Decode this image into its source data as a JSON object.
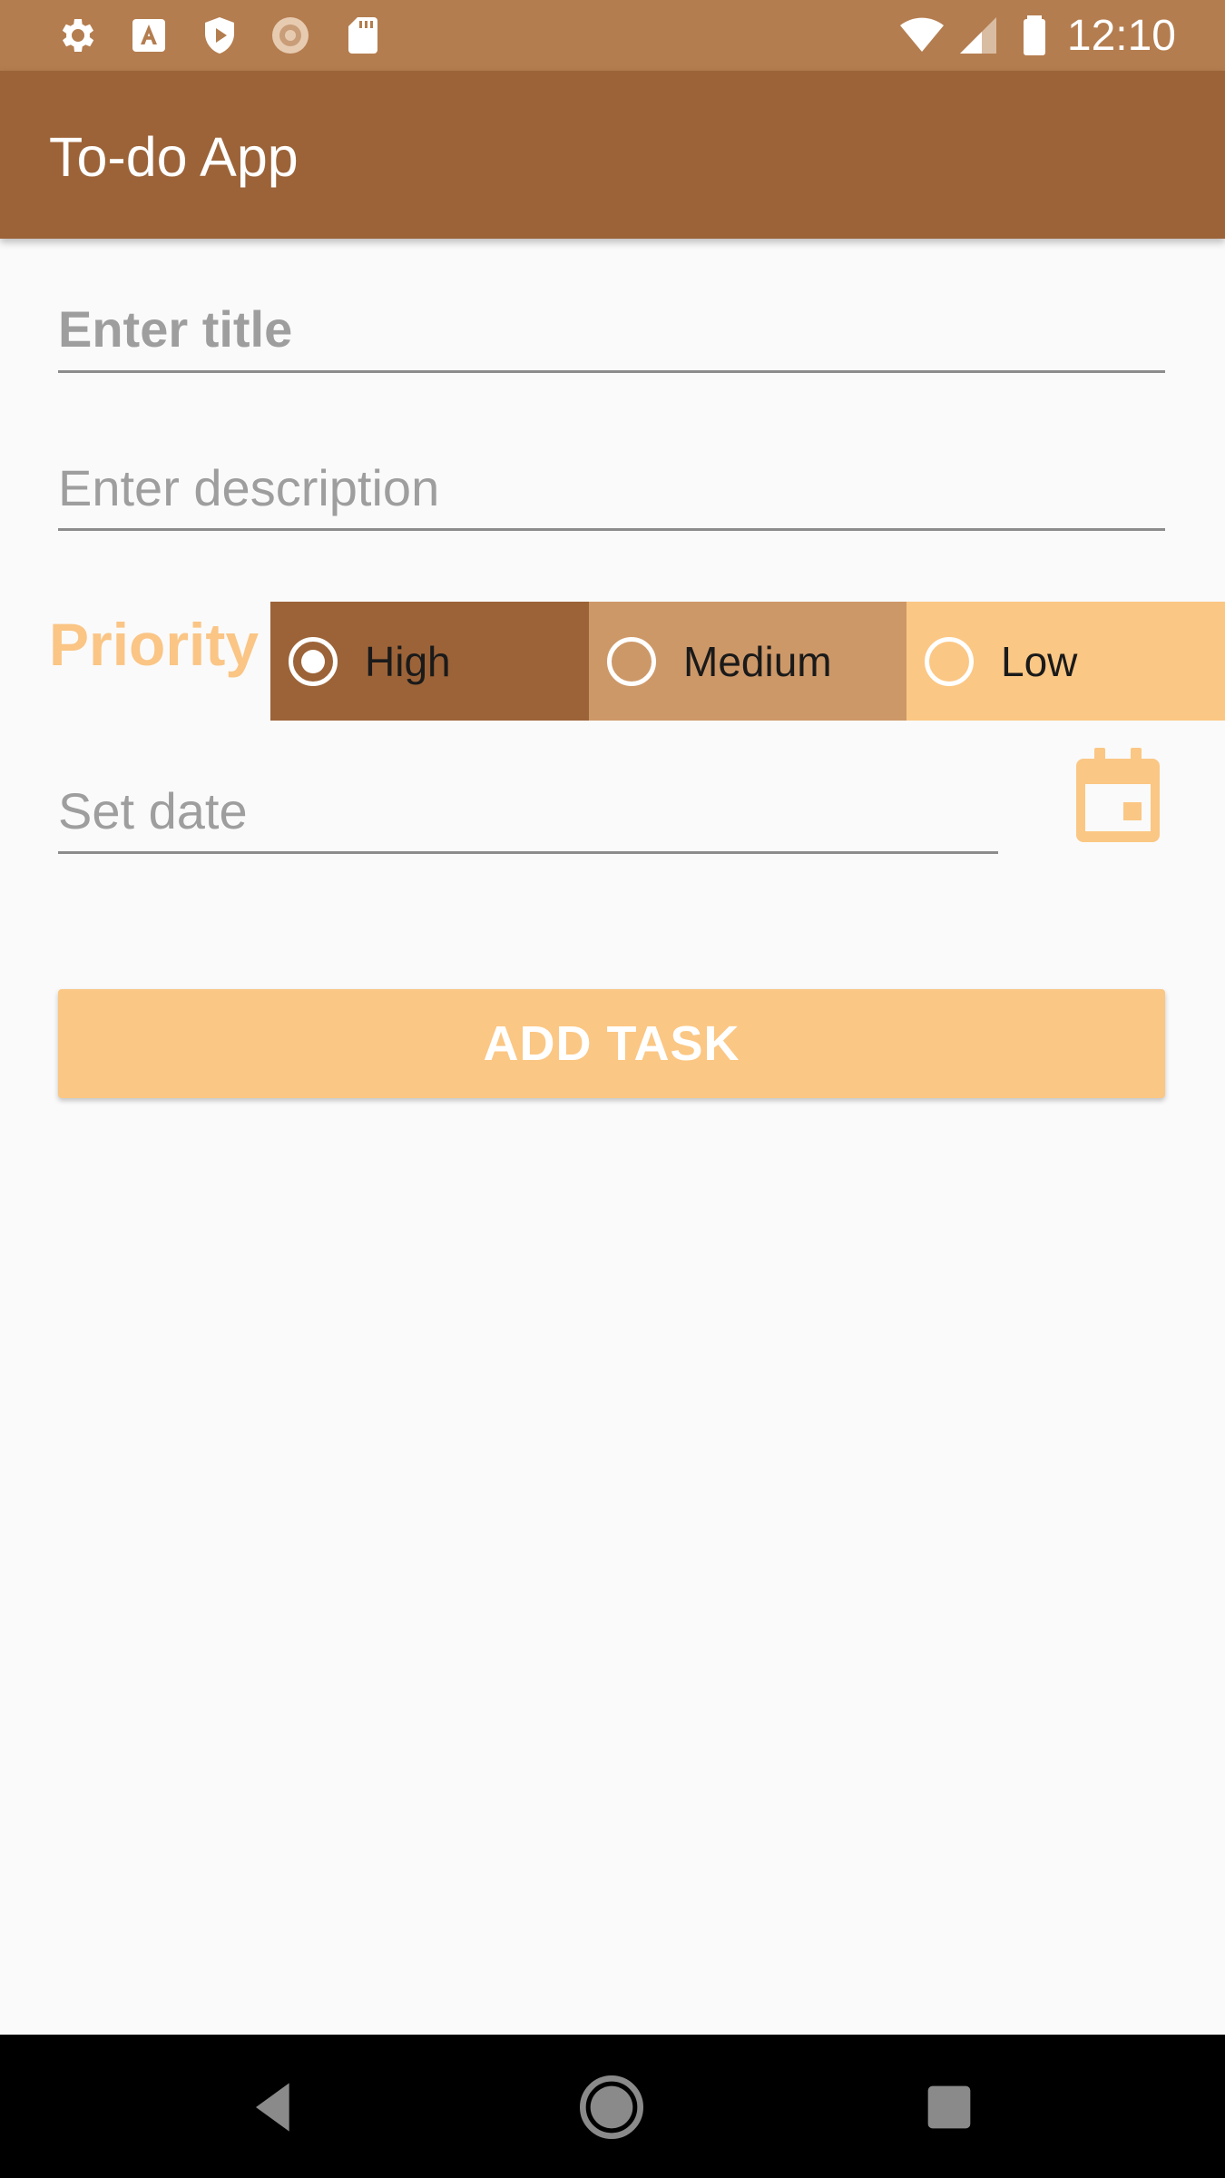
{
  "status_bar": {
    "time": "12:10",
    "left_icons": [
      "settings-icon",
      "a-square-icon",
      "play-shield-icon",
      "sunburst-icon",
      "sd-card-icon"
    ],
    "right_icons": [
      "wifi-icon",
      "signal-icon",
      "battery-icon"
    ]
  },
  "app_bar": {
    "title": "To-do App"
  },
  "form": {
    "title_placeholder": "Enter title",
    "title_value": "",
    "description_placeholder": "Enter description",
    "description_value": "",
    "date_placeholder": "Set date",
    "date_value": ""
  },
  "priority": {
    "label": "Priority",
    "options": [
      {
        "label": "High",
        "selected": true,
        "color": "#9c6338"
      },
      {
        "label": "Medium",
        "selected": false,
        "color": "#cd9868"
      },
      {
        "label": "Low",
        "selected": false,
        "color": "#fbc784"
      }
    ]
  },
  "calendar": {
    "icon": "calendar-icon",
    "color": "#fbc784"
  },
  "actions": {
    "add_task_label": "ADD TASK"
  },
  "nav_bar": {
    "buttons": [
      "back-icon",
      "home-icon",
      "recents-icon"
    ]
  },
  "colors": {
    "status_bar": "#b47d4f",
    "app_bar": "#9c6338",
    "accent": "#fbc784",
    "background": "#fafafa"
  }
}
